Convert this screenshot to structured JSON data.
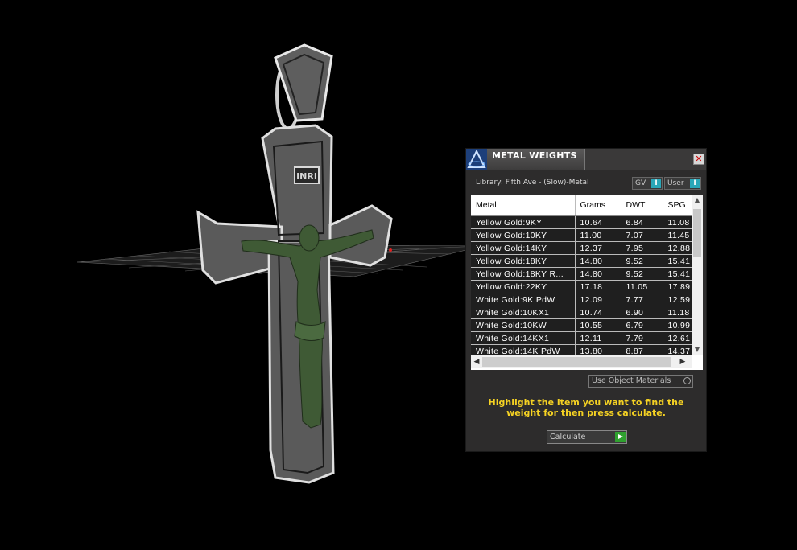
{
  "panel": {
    "title": "METAL WEIGHTS",
    "library_label": "Library: Fifth Ave - (Slow)-Metal",
    "toggles": [
      {
        "label": "GV",
        "knob": "I"
      },
      {
        "label": "User",
        "knob": "I"
      }
    ],
    "table": {
      "columns": [
        "Metal",
        "Grams",
        "DWT",
        "SPG"
      ],
      "rows": [
        [
          "Yellow Gold:9KY",
          "10.64",
          "6.84",
          "11.08"
        ],
        [
          "Yellow Gold:10KY",
          "11.00",
          "7.07",
          "11.45"
        ],
        [
          "Yellow Gold:14KY",
          "12.37",
          "7.95",
          "12.88"
        ],
        [
          "Yellow Gold:18KY",
          "14.80",
          "9.52",
          "15.41"
        ],
        [
          "Yellow Gold:18KY R...",
          "14.80",
          "9.52",
          "15.41"
        ],
        [
          "Yellow Gold:22KY",
          "17.18",
          "11.05",
          "17.89"
        ],
        [
          "White Gold:9K PdW",
          "12.09",
          "7.77",
          "12.59"
        ],
        [
          "White Gold:10KX1",
          "10.74",
          "6.90",
          "11.18"
        ],
        [
          "White Gold:10KW",
          "10.55",
          "6.79",
          "10.99"
        ],
        [
          "White Gold:14KX1",
          "12.11",
          "7.79",
          "12.61"
        ],
        [
          "White Gold:14K PdW",
          "13.80",
          "8.87",
          "14.37"
        ]
      ]
    },
    "use_object_materials": "Use Object Materials",
    "hint": "Highlight the item you want to find the weight for then press calculate.",
    "calculate_label": "Calculate",
    "close_label": "✕"
  },
  "colors": {
    "panel_bg": "#2d2c2c",
    "hint_text": "#f5d223",
    "toggle_knob": "#2aa7b8",
    "calc_play": "#2fa12f",
    "figure_green": "#3f5a35",
    "cross_face": "#5a5a5a"
  }
}
